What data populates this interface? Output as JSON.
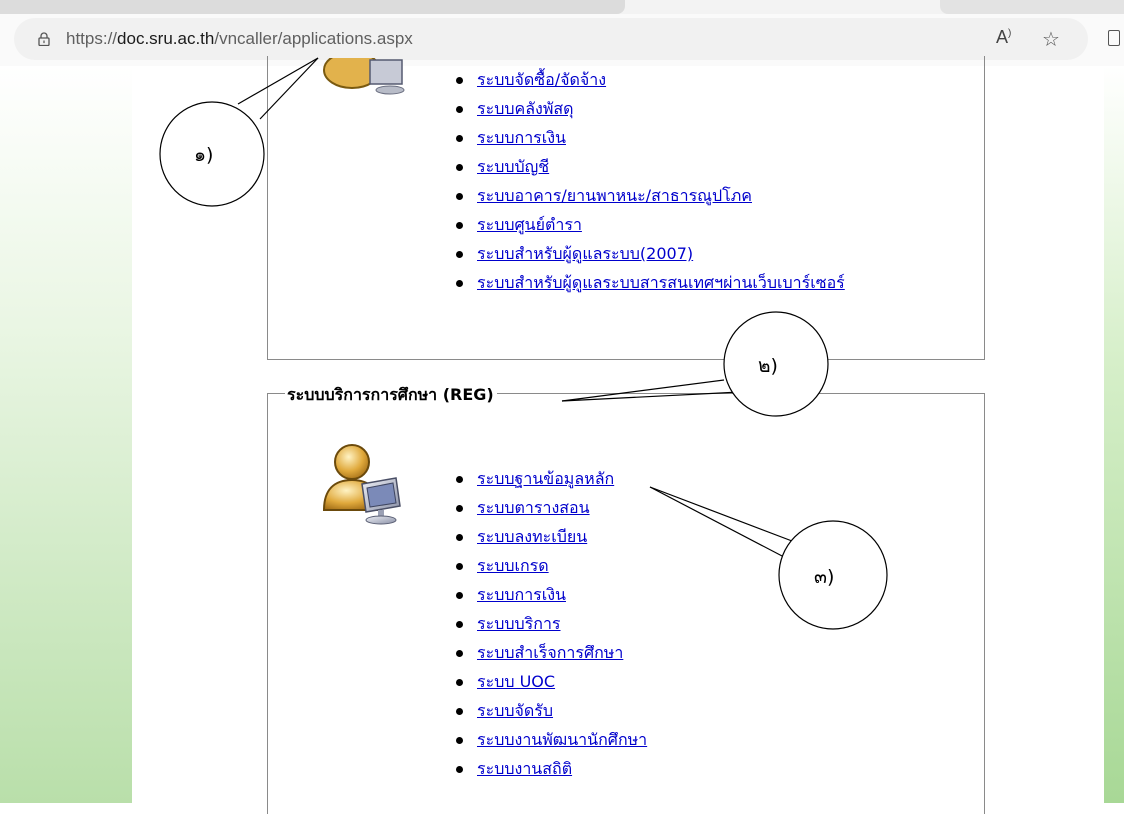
{
  "browser": {
    "url_prefix": "https://",
    "url_host": "doc.sru.ac.th",
    "url_path": "/vncaller/applications.aspx",
    "read_aloud_label": "A⁾",
    "favorite_icon": "☆"
  },
  "section1": {
    "links": [
      "ระบบจัดซื้อ/จัดจ้าง",
      "ระบบคลังพัสดุ",
      "ระบบการเงิน",
      "ระบบบัญชี",
      "ระบบอาคาร/ยานพาหนะ/สาธารณูปโภค",
      "ระบบศูนย์ตำรา",
      "ระบบสำหรับผู้ดูแลระบบ(2007)",
      "ระบบสำหรับผู้ดูแลระบบสารสนเทศฯผ่านเว็บเบาร์เซอร์"
    ]
  },
  "section2": {
    "title": "ระบบบริการการศึกษา (REG)",
    "links": [
      "ระบบฐานข้อมูลหลัก",
      "ระบบตารางสอน",
      "ระบบลงทะเบียน",
      "ระบบเกรด",
      "ระบบการเงิน",
      "ระบบบริการ",
      "ระบบสำเร็จการศึกษา",
      "ระบบ UOC",
      "ระบบจัดรับ",
      "ระบบงานพัฒนานักศึกษา",
      "ระบบงานสถิติ"
    ]
  },
  "annotations": {
    "callout1": "๑)",
    "callout2": "๒)",
    "callout3": "๓)"
  }
}
